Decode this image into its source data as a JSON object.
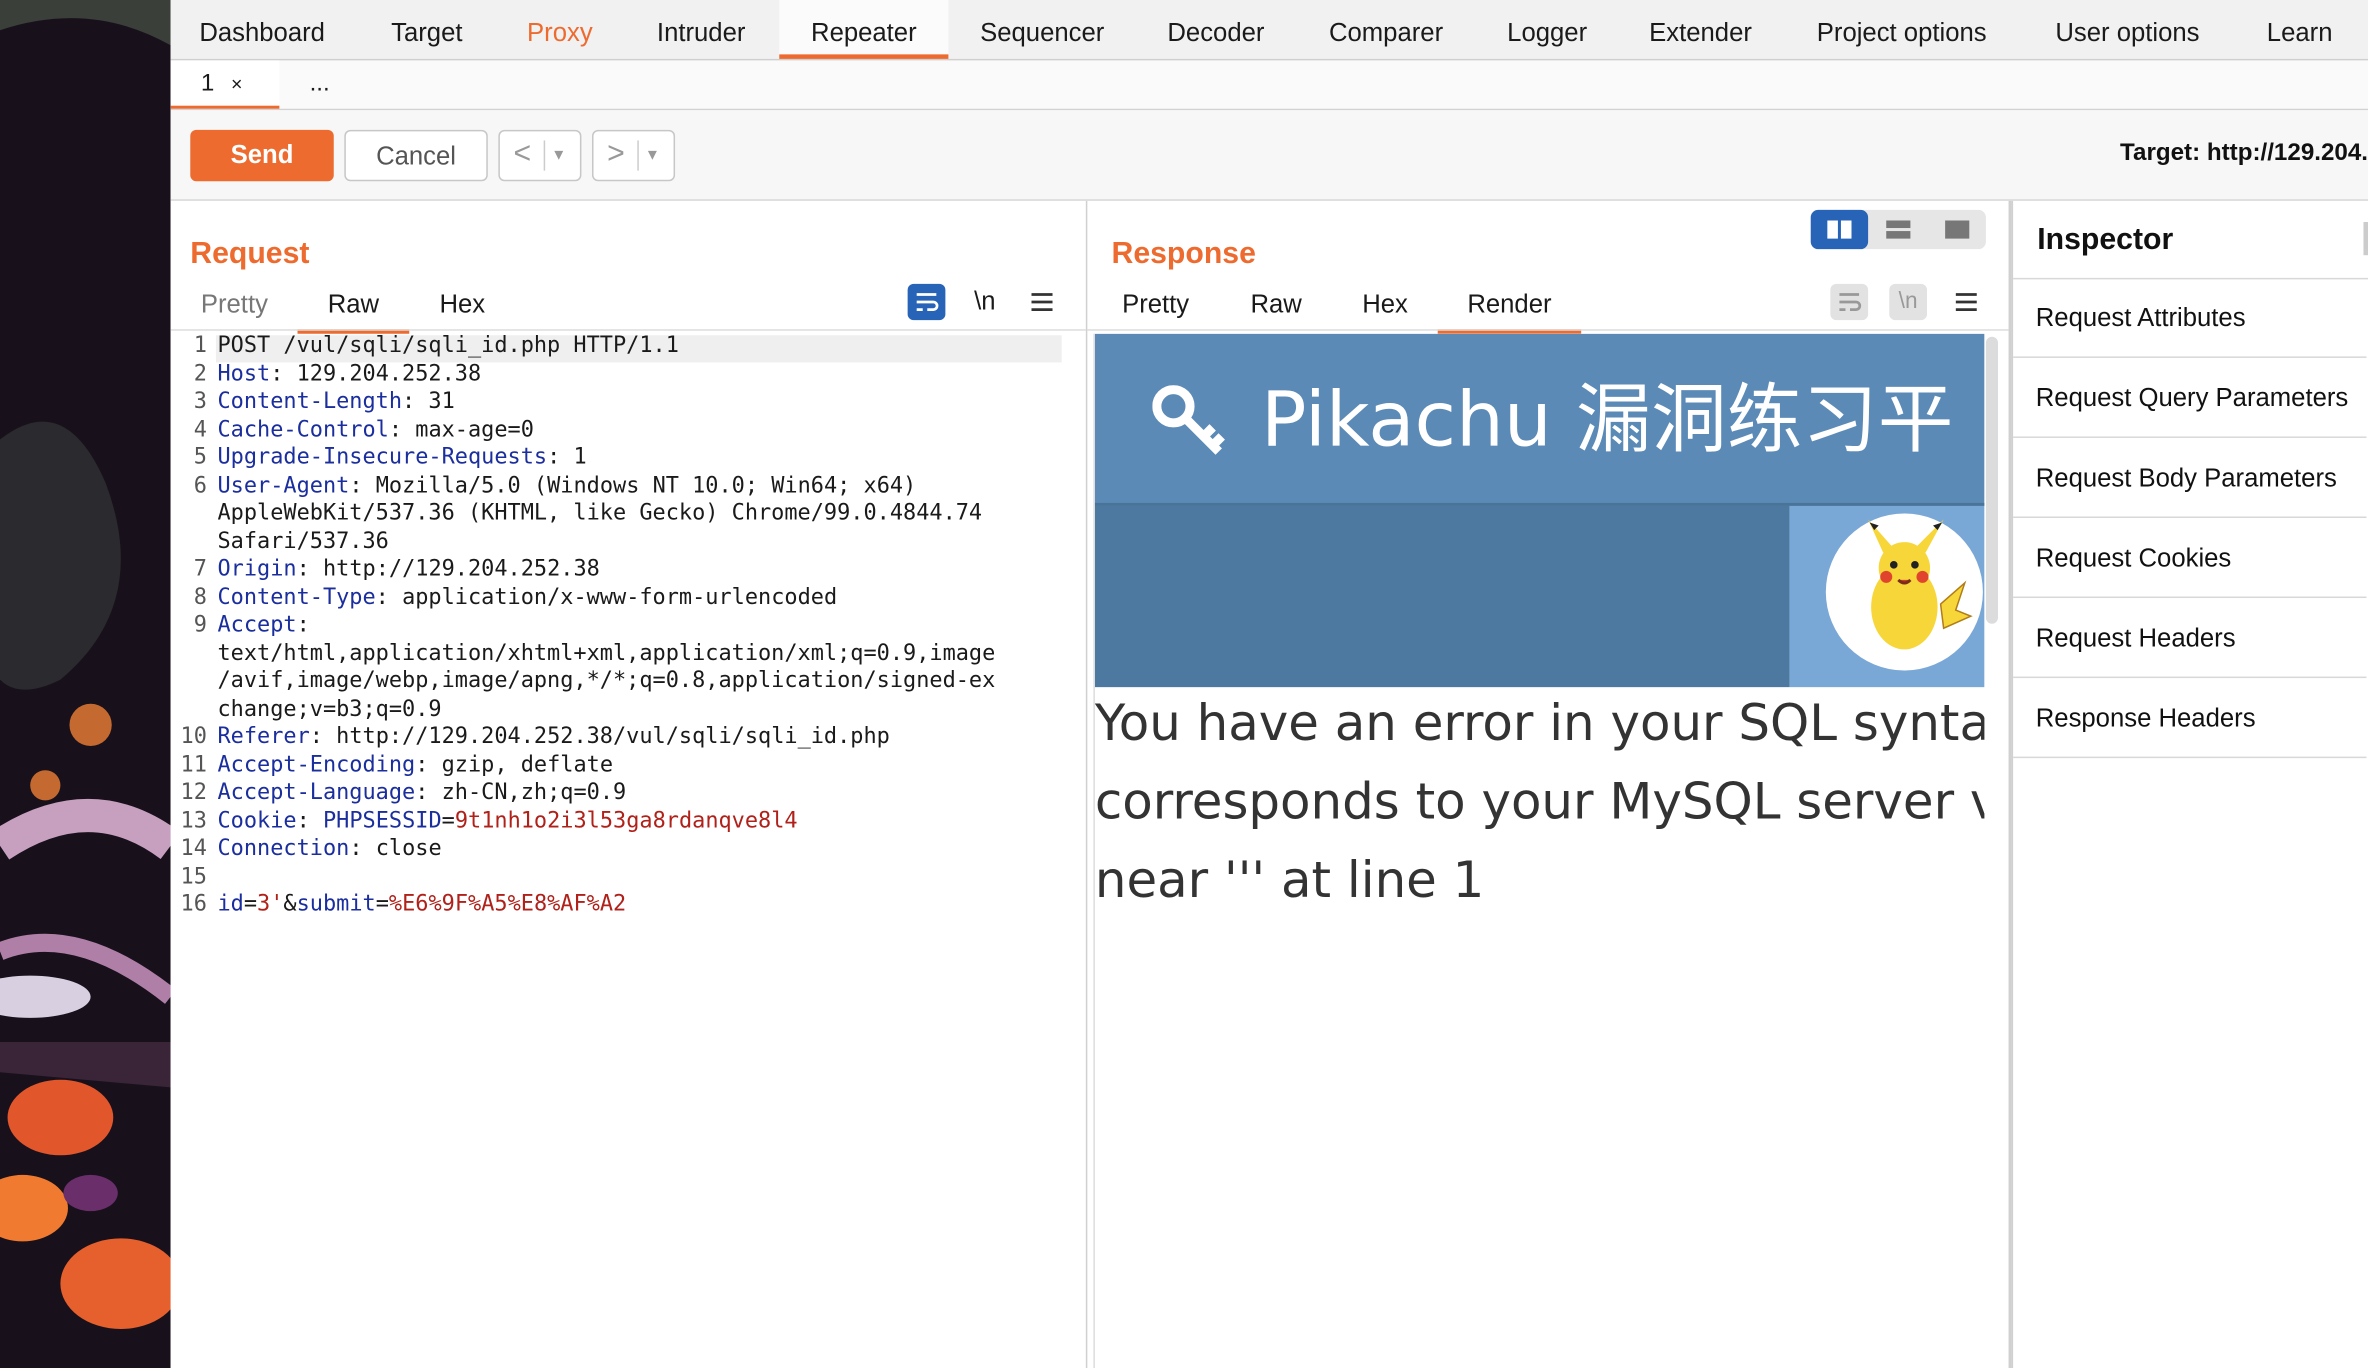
{
  "nav": {
    "tabs": [
      "Dashboard",
      "Target",
      "Proxy",
      "Intruder",
      "Repeater",
      "Sequencer",
      "Decoder",
      "Comparer",
      "Logger",
      "Extender",
      "Project options",
      "User options",
      "Learn"
    ]
  },
  "subtabs": {
    "tab1": "1",
    "tab1_close": "×",
    "more": "..."
  },
  "toolbar": {
    "send": "Send",
    "cancel": "Cancel",
    "back": "<",
    "forward": ">",
    "dropdown": "▾",
    "target": "Target: http://129.204."
  },
  "request": {
    "title": "Request",
    "tabs": {
      "pretty": "Pretty",
      "raw": "Raw",
      "hex": "Hex"
    },
    "newline_label": "\\n",
    "lines": [
      {
        "n": "1",
        "k": "",
        "s": "",
        "v": "POST /vul/sqli/sqli_id.php HTTP/1.1"
      },
      {
        "n": "2",
        "k": "Host",
        "s": ": ",
        "v": "129.204.252.38"
      },
      {
        "n": "3",
        "k": "Content-Length",
        "s": ": ",
        "v": "31"
      },
      {
        "n": "4",
        "k": "Cache-Control",
        "s": ": ",
        "v": "max-age=0"
      },
      {
        "n": "5",
        "k": "Upgrade-Insecure-Requests",
        "s": ": ",
        "v": "1"
      },
      {
        "n": "6",
        "k": "User-Agent",
        "s": ": ",
        "v": "Mozilla/5.0 (Windows NT 10.0; Win64; x64)"
      },
      {
        "n": "",
        "k": "",
        "s": "",
        "v": "AppleWebKit/537.36 (KHTML, like Gecko) Chrome/99.0.4844.74"
      },
      {
        "n": "",
        "k": "",
        "s": "",
        "v": "Safari/537.36"
      },
      {
        "n": "7",
        "k": "Origin",
        "s": ": ",
        "v": "http://129.204.252.38"
      },
      {
        "n": "8",
        "k": "Content-Type",
        "s": ": ",
        "v": "application/x-www-form-urlencoded"
      },
      {
        "n": "9",
        "k": "Accept",
        "s": ":",
        "v": ""
      },
      {
        "n": "",
        "k": "",
        "s": "",
        "v": "text/html,application/xhtml+xml,application/xml;q=0.9,image"
      },
      {
        "n": "",
        "k": "",
        "s": "",
        "v": "/avif,image/webp,image/apng,*/*;q=0.8,application/signed-ex"
      },
      {
        "n": "",
        "k": "",
        "s": "",
        "v": "change;v=b3;q=0.9"
      },
      {
        "n": "10",
        "k": "Referer",
        "s": ": ",
        "v": "http://129.204.252.38/vul/sqli/sqli_id.php"
      },
      {
        "n": "11",
        "k": "Accept-Encoding",
        "s": ": ",
        "v": "gzip, deflate"
      },
      {
        "n": "12",
        "k": "Accept-Language",
        "s": ": ",
        "v": "zh-CN,zh;q=0.9"
      },
      {
        "n": "13",
        "k": "Cookie",
        "s": ": ",
        "v": "",
        "ck": "PHPSESSID",
        "ce": "=",
        "cv": "9t1nh1o2i3l53ga8rdanqve8l4"
      },
      {
        "n": "14",
        "k": "Connection",
        "s": ": ",
        "v": "close"
      },
      {
        "n": "15",
        "k": "",
        "s": "",
        "v": ""
      },
      {
        "n": "16",
        "k": "",
        "s": "",
        "v": "",
        "body": [
          [
            "k",
            "id"
          ],
          [
            "e",
            "="
          ],
          [
            "v",
            "3'"
          ],
          [
            "e",
            "&"
          ],
          [
            "k",
            "submit"
          ],
          [
            "e",
            "="
          ],
          [
            "v",
            "%E6%9F%A5%E8%AF%A2"
          ]
        ]
      }
    ]
  },
  "response": {
    "title": "Response",
    "tabs": {
      "pretty": "Pretty",
      "raw": "Raw",
      "hex": "Hex",
      "render": "Render"
    },
    "newline_label": "\\n",
    "render": {
      "site_title": "Pikachu 漏洞练习平",
      "error_lines": [
        "You have an error in your SQL syntax",
        "corresponds to your MySQL server ve",
        "near ''' at line 1"
      ]
    }
  },
  "inspector": {
    "title": "Inspector",
    "items": [
      "Request Attributes",
      "Request Query Parameters",
      "Request Body Parameters",
      "Request Cookies",
      "Request Headers",
      "Response Headers"
    ]
  },
  "colors": {
    "accent": "#ee6b2f",
    "header_key": "#1b2e9e",
    "header_value_red": "#b0211a",
    "render_banner": "#5b8ab6"
  }
}
